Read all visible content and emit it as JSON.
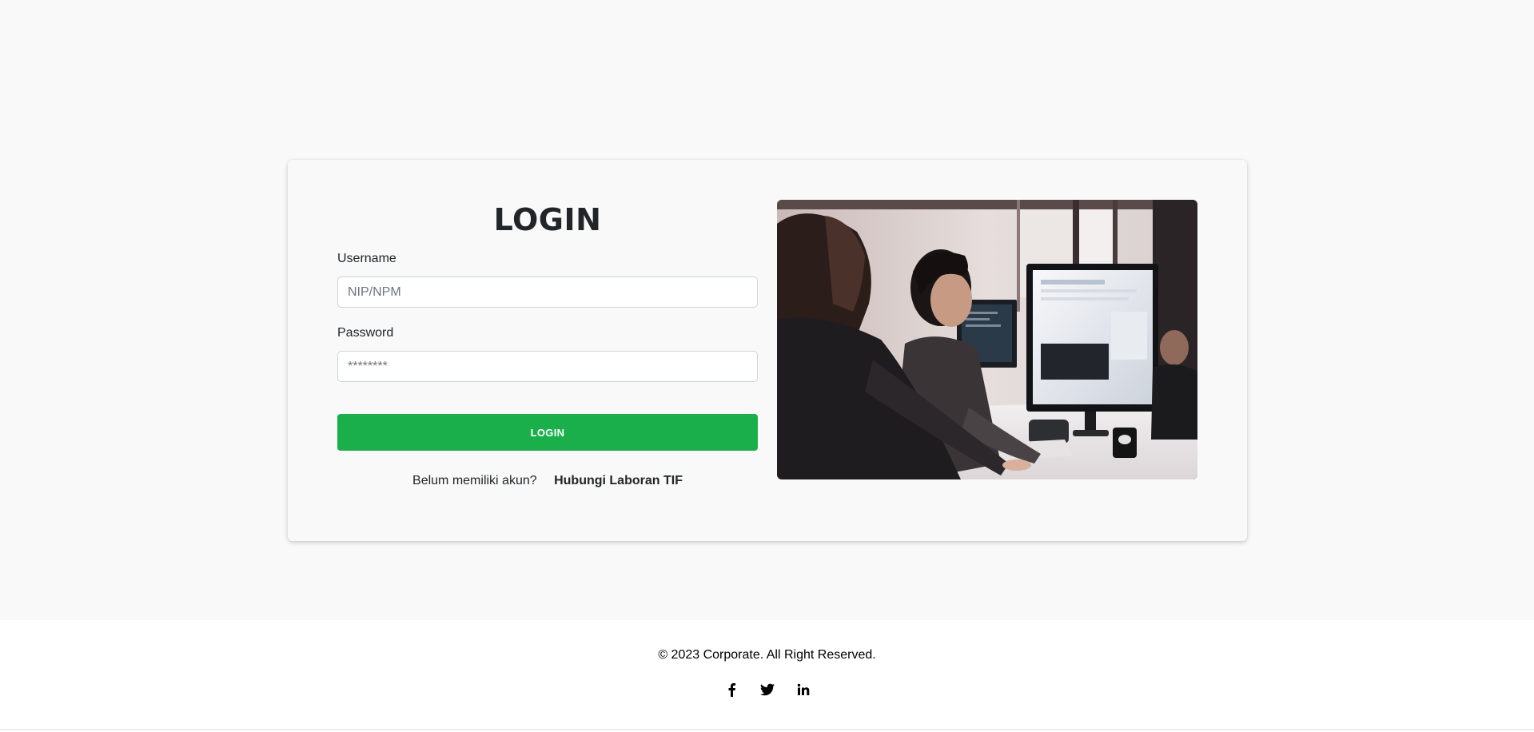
{
  "login": {
    "title": "LOGIN",
    "username_label": "Username",
    "username_placeholder": "NIP/NPM",
    "username_value": "",
    "password_label": "Password",
    "password_placeholder": "********",
    "password_value": "",
    "submit_label": "LOGIN",
    "signup_question": "Belum memiliki akun?",
    "signup_link": "Hubungi Laboran TIF",
    "button_color": "#1aaf4b"
  },
  "hero_image": {
    "description_icon": "office-photo"
  },
  "footer": {
    "copyright": "© 2023 Corporate. All Right Reserved.",
    "socials": [
      "facebook",
      "twitter",
      "linkedin"
    ]
  }
}
